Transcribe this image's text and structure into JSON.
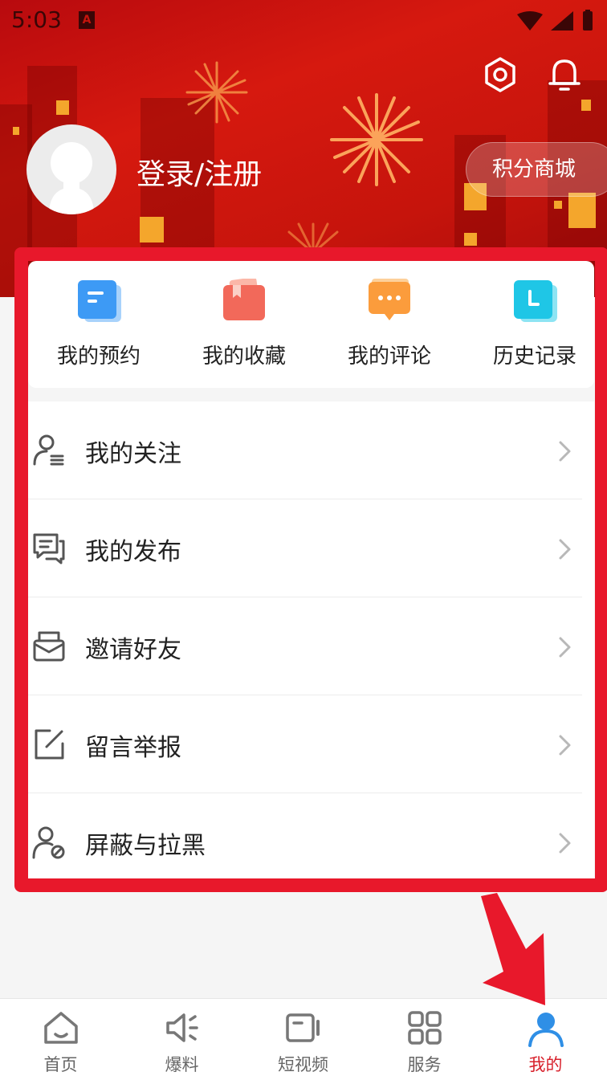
{
  "status_bar": {
    "time": "5:03",
    "app_badge": "A",
    "text_color": "#3a0606"
  },
  "header": {
    "login_text": "登录/注册",
    "points_mall_label": "积分商城",
    "settings_icon": "settings-hexagon-icon",
    "notification_icon": "bell-icon",
    "bg_color": "#c6140c"
  },
  "quick_actions": [
    {
      "label": "我的预约",
      "icon": "calendar-card-icon",
      "color": "#3d9af5"
    },
    {
      "label": "我的收藏",
      "icon": "bookmark-folder-icon",
      "color": "#f2695a"
    },
    {
      "label": "我的评论",
      "icon": "chat-bubble-icon",
      "color": "#fb9c3c"
    },
    {
      "label": "历史记录",
      "icon": "clock-icon",
      "color": "#1fc6e6"
    }
  ],
  "menu": [
    {
      "label": "我的关注",
      "icon": "user-list-icon"
    },
    {
      "label": "我的发布",
      "icon": "chat-lines-icon"
    },
    {
      "label": "邀请好友",
      "icon": "envelope-icon"
    },
    {
      "label": "留言举报",
      "icon": "edit-square-icon"
    },
    {
      "label": "屏蔽与拉黑",
      "icon": "user-block-icon"
    }
  ],
  "bottom_nav": [
    {
      "label": "首页",
      "icon": "home-icon",
      "active": false
    },
    {
      "label": "爆料",
      "icon": "speaker-icon",
      "active": false
    },
    {
      "label": "短视频",
      "icon": "video-icon",
      "active": false
    },
    {
      "label": "服务",
      "icon": "grid-icon",
      "active": false
    },
    {
      "label": "我的",
      "icon": "person-icon",
      "active": true
    }
  ],
  "colors": {
    "accent": "#d8202b",
    "highlight_border": "#e8182b",
    "active_icon": "#2f8fe6"
  }
}
